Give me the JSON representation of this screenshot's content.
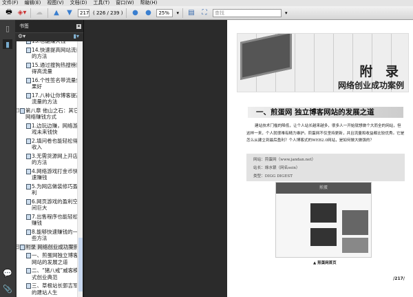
{
  "menu": [
    "文件(F)",
    "编辑(E)",
    "视图(V)",
    "文档(D)",
    "工具(T)",
    "窗口(W)",
    "帮助(H)"
  ],
  "toolbar": {
    "page_value": "217",
    "page_count": "( 226 / 239 )",
    "zoom_value": "25%",
    "search_placeholder": "查找"
  },
  "panel": {
    "title": "书签"
  },
  "bookmarks": [
    {
      "label": "13.也能赚大钱",
      "level": 2
    },
    {
      "label": "14.快速提高网站流量的方法",
      "level": 2
    },
    {
      "label": "15.通过搜狗热搜榜获得高流量",
      "level": 2
    },
    {
      "label": "16.个性签名带流量效果好",
      "level": 2
    },
    {
      "label": "17.八种让你博客提高流量的方法",
      "level": 2
    },
    {
      "label": "第八章  他山之石：其它网络赚钱方式",
      "level": 1
    },
    {
      "label": "1.边玩边赚，网络游戏未来钱快",
      "level": 2
    },
    {
      "label": "2.填问卷也能轻松得收入",
      "level": 2
    },
    {
      "label": "3.无需货源网上开店的方法",
      "level": 2
    },
    {
      "label": "4.网络游戏打金币快速赚钱",
      "level": 2
    },
    {
      "label": "5.为网店做装修巧盈利",
      "level": 2
    },
    {
      "label": "6.网页游戏的盈利空间巨大",
      "level": 2
    },
    {
      "label": "7.出售程序也能轻松赚钱",
      "level": 2
    },
    {
      "label": "8.能够快速赚钱的一些方法",
      "level": 2
    },
    {
      "label": "附录  网络创业成功案例",
      "level": 1,
      "selected": true
    },
    {
      "label": "一、煎蛋网独立博客网站的发展之道",
      "level": 2
    },
    {
      "label": "二、“猪八戒”威客模式创业典范",
      "level": 2
    },
    {
      "label": "三、草根站长郭吉军的建站人生",
      "level": 2
    }
  ],
  "document": {
    "banner_title": "附 录",
    "banner_subtitle": "网络创业成功案例",
    "section_title": "一、煎蛋网 独立博客网站的发展之道",
    "paragraph": "建站技术门槛的降低，让个人站长越来越多，很多人一开始就想做个大而全的网站，但这样一来，个人就很难有精力维护。煎蛋网不仅坚持更新，并且流量和收益都比较优秀。它是怎么从建立到最后盈利？个人博客式的WEB2.0网站，是如何做大做强的？",
    "info": [
      "网站：煎蛋网（www.jandan.net）",
      "站长：綠水银（网名sein）",
      "类型：DIGG DIGEST"
    ],
    "screenshot_header": "煎蛋",
    "caption": "▲ 煎蛋网首页",
    "page_number": "/217/"
  }
}
